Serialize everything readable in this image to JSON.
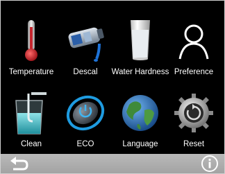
{
  "menu": {
    "items": [
      {
        "id": "temperature",
        "label": "Temperature",
        "icon": "thermometer-icon"
      },
      {
        "id": "descal",
        "label": "Descal",
        "icon": "descale-cartridge-icon"
      },
      {
        "id": "water-hardness",
        "label": "Water Hardness",
        "icon": "water-glass-icon"
      },
      {
        "id": "preference",
        "label": "Preference",
        "icon": "user-icon"
      },
      {
        "id": "clean",
        "label": "Clean",
        "icon": "cleaning-beaker-icon"
      },
      {
        "id": "eco",
        "label": "ECO",
        "icon": "eco-power-icon"
      },
      {
        "id": "language",
        "label": "Language",
        "icon": "globe-icon"
      },
      {
        "id": "reset",
        "label": "Reset",
        "icon": "gear-reset-icon"
      }
    ]
  },
  "bottom_bar": {
    "back_icon": "back-arrow-icon",
    "info_icon": "info-icon"
  },
  "colors": {
    "background": "#000000",
    "bar": "#a9a9a9",
    "eco_accent": "#1e9be0",
    "thermometer": "#c4262e"
  }
}
